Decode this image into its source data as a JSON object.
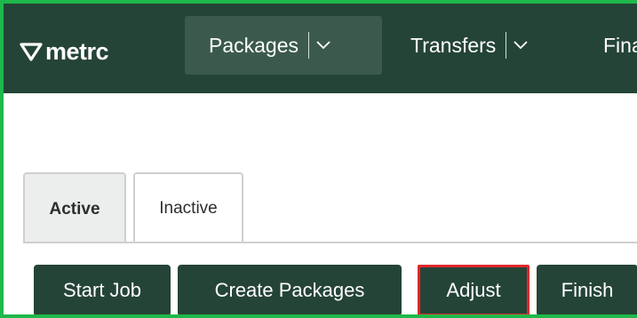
{
  "app": {
    "logo_text": "metrc"
  },
  "nav": {
    "items": [
      {
        "label": "Packages",
        "active": true
      },
      {
        "label": "Transfers",
        "active": false
      },
      {
        "label": "Fina",
        "active": false
      }
    ]
  },
  "tabs": [
    {
      "label": "Active",
      "selected": true
    },
    {
      "label": "Inactive",
      "selected": false
    }
  ],
  "toolbar": {
    "start_job": "Start Job",
    "create_packages": "Create Packages",
    "adjust": "Adjust",
    "finish": "Finish"
  },
  "colors": {
    "navbar": "#254438",
    "button": "#254438",
    "highlight_frame": "#1fb84a",
    "adjust_outline": "#e0262a"
  },
  "icons": [
    "metrc-logo-icon",
    "chevron-down-icon"
  ]
}
